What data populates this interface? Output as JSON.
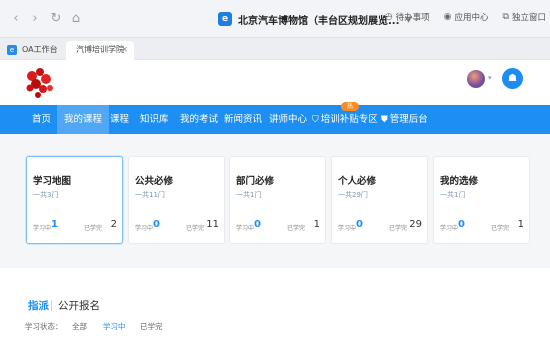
{
  "browser": {
    "address_title": "北京汽车博物馆（丰台区规划展览...",
    "right_items": [
      "待办事项",
      "应用中心",
      "独立窗口"
    ],
    "tabs": [
      {
        "label": "OA工作台",
        "active": false
      },
      {
        "label": "汽博培训学院",
        "active": true
      }
    ]
  },
  "nav": {
    "items": [
      "首页",
      "我的课程",
      "课程",
      "知识库",
      "我的考试",
      "新闻资讯",
      "讲师中心",
      "培训补贴专区",
      "管理后台"
    ],
    "active_index": 1,
    "badge": "热"
  },
  "cards": [
    {
      "title": "学习地图",
      "subtitle": "一共3门",
      "study_label": "学习中",
      "study": "1",
      "done_label": "已学完",
      "done": "2"
    },
    {
      "title": "公共必修",
      "subtitle": "一共11门",
      "study_label": "学习中",
      "study": "0",
      "done_label": "已学完",
      "done": "11"
    },
    {
      "title": "部门必修",
      "subtitle": "一共1门",
      "study_label": "学习中",
      "study": "0",
      "done_label": "已学完",
      "done": "1"
    },
    {
      "title": "个人必修",
      "subtitle": "一共29门",
      "study_label": "学习中",
      "study": "0",
      "done_label": "已学完",
      "done": "29"
    },
    {
      "title": "我的选修",
      "subtitle": "一共1门",
      "study_label": "学习中",
      "study": "0",
      "done_label": "已学完",
      "done": "1"
    }
  ],
  "lower": {
    "tab_assigned": "指派",
    "tab_public": "公开报名",
    "filter_label": "学习状态：",
    "filter_options": [
      "全部",
      "学习中",
      "已学完"
    ],
    "filter_active_index": 1
  },
  "colors": {
    "accent": "#1e8ff2",
    "badge": "#ff8a1f"
  }
}
